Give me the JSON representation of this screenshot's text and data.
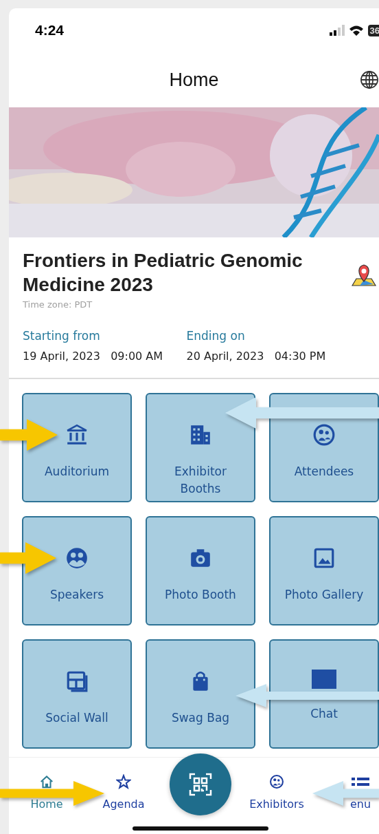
{
  "status_bar": {
    "time": "4:24",
    "battery": "36"
  },
  "header": {
    "title": "Home"
  },
  "event": {
    "title": "Frontiers in Pediatric Genomic Medicine 2023",
    "time_zone": "Time zone: PDT",
    "start": {
      "label": "Starting from",
      "date": "19 April, 2023",
      "time": "09:00 AM"
    },
    "end": {
      "label": "Ending on",
      "date": "20 April, 2023",
      "time": "04:30 PM"
    }
  },
  "tiles": [
    {
      "label": "Auditorium"
    },
    {
      "label": "Exhibitor Booths"
    },
    {
      "label": "Attendees"
    },
    {
      "label": "Speakers"
    },
    {
      "label": "Photo Booth"
    },
    {
      "label": "Photo Gallery"
    },
    {
      "label": "Social Wall"
    },
    {
      "label": "Swag Bag"
    },
    {
      "label": "Chat"
    }
  ],
  "nav": [
    {
      "label": "Home",
      "selected": true
    },
    {
      "label": "Agenda",
      "selected": false
    },
    {
      "label": "Exhibitors",
      "selected": false
    },
    {
      "label": "enu",
      "selected": false
    }
  ],
  "annotation_arrows": [
    {
      "kind": "right",
      "color": "#f7c600"
    },
    {
      "kind": "left",
      "color": "#c6e4f2"
    },
    {
      "kind": "right",
      "color": "#f7c600"
    },
    {
      "kind": "left",
      "color": "#c6e4f2"
    },
    {
      "kind": "right",
      "color": "#f7c600"
    },
    {
      "kind": "left",
      "color": "#c6e4f2"
    }
  ]
}
